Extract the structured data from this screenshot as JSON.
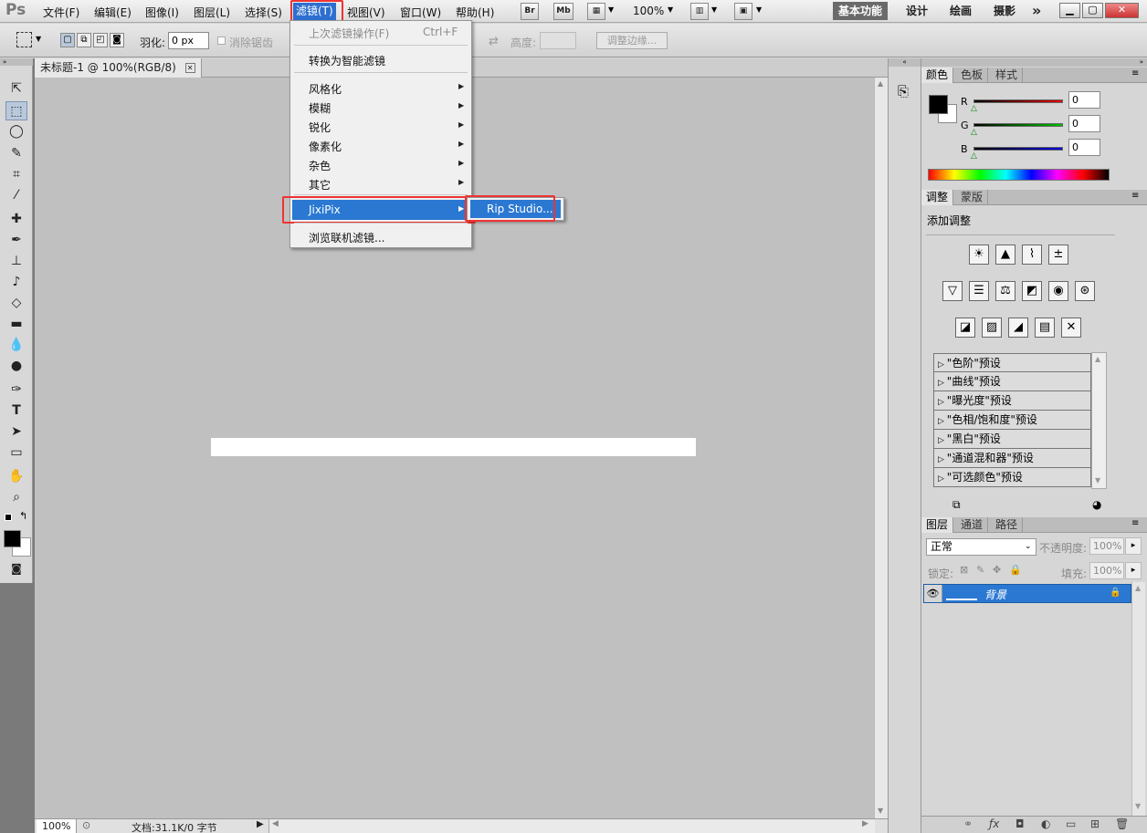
{
  "app": {
    "logo": "Ps"
  },
  "menubar": {
    "items": [
      "文件(F)",
      "编辑(E)",
      "图像(I)",
      "图层(L)",
      "选择(S)",
      "滤镜(T)",
      "视图(V)",
      "窗口(W)",
      "帮助(H)"
    ],
    "br_label": "Br",
    "mb_label": "Mb",
    "zoom": "100%",
    "workspaces": [
      "基本功能",
      "设计",
      "绘画",
      "摄影"
    ],
    "more": "»"
  },
  "options": {
    "feather_label": "羽化:",
    "feather_value": "0 px",
    "antialias_label": "消除锯齿",
    "height_label": "高度:",
    "refine_edge": "调整边缘..."
  },
  "document": {
    "tab_title": "未标题-1 @ 100%(RGB/8)",
    "status_zoom": "100%",
    "status_info": "文档:31.1K/0 字节"
  },
  "filter_menu": {
    "last_filter": "上次滤镜操作(F)",
    "last_filter_shortcut": "Ctrl+F",
    "smart_filter": "转换为智能滤镜",
    "stylize": "风格化",
    "blur": "模糊",
    "sharpen": "锐化",
    "pixelate": "像素化",
    "noise": "杂色",
    "other": "其它",
    "jixipix": "JixiPix",
    "browse_online": "浏览联机滤镜...",
    "submenu": {
      "rip_studio": "Rip Studio..."
    }
  },
  "color_panel": {
    "tabs": [
      "颜色",
      "色板",
      "样式"
    ],
    "channels": [
      {
        "label": "R",
        "value": "0",
        "color": "#e00000"
      },
      {
        "label": "G",
        "value": "0",
        "color": "#00c000"
      },
      {
        "label": "B",
        "value": "0",
        "color": "#0000e0"
      }
    ]
  },
  "adjust_panel": {
    "tabs": [
      "调整",
      "蒙版"
    ],
    "title": "添加调整",
    "presets": [
      "\"色阶\"预设",
      "\"曲线\"预设",
      "\"曝光度\"预设",
      "\"色相/饱和度\"预设",
      "\"黑白\"预设",
      "\"通道混和器\"预设",
      "\"可选颜色\"预设"
    ]
  },
  "layers_panel": {
    "tabs": [
      "图层",
      "通道",
      "路径"
    ],
    "blend_mode": "正常",
    "opacity_label": "不透明度:",
    "opacity_value": "100%",
    "lock_label": "锁定:",
    "fill_label": "填充:",
    "fill_value": "100%",
    "layer_name": "背景"
  },
  "colors": {
    "menu_highlight": "#2b78d2",
    "annotation_red": "#e33333"
  }
}
